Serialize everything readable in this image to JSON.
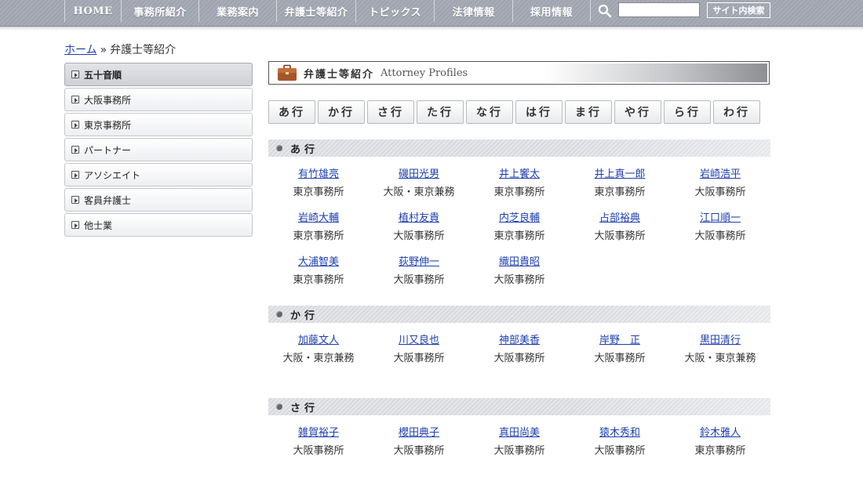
{
  "nav": {
    "items": [
      "HOME",
      "事務所紹介",
      "業務案内",
      "弁護士等紹介",
      "トピックス",
      "法律情報",
      "採用情報"
    ],
    "search_placeholder": "",
    "search_button": "サイト内検索"
  },
  "breadcrumb": {
    "home": "ホーム",
    "separator": "»",
    "current": "弁護士等紹介"
  },
  "sidebar": {
    "items": [
      "五十音順",
      "大阪事務所",
      "東京事務所",
      "パートナー",
      "アソシエイト",
      "客員弁護士",
      "他士業"
    ],
    "active": "五十音順"
  },
  "main": {
    "title_jp": "弁護士等紹介",
    "title_en": "Attorney Profiles",
    "kana": [
      "あ行",
      "か行",
      "さ行",
      "た行",
      "な行",
      "は行",
      "ま行",
      "や行",
      "ら行",
      "わ行"
    ],
    "sections": [
      {
        "title": "あ行",
        "people": [
          {
            "name": "有竹雄亮",
            "office": "東京事務所"
          },
          {
            "name": "磯田光男",
            "office": "大阪・東京兼務"
          },
          {
            "name": "井上饗太",
            "office": "東京事務所"
          },
          {
            "name": "井上真一郎",
            "office": "東京事務所"
          },
          {
            "name": "岩崎浩平",
            "office": "大阪事務所"
          },
          {
            "name": "岩崎大輔",
            "office": "東京事務所"
          },
          {
            "name": "植村友貴",
            "office": "大阪事務所"
          },
          {
            "name": "内芝良輔",
            "office": "東京事務所"
          },
          {
            "name": "占部裕典",
            "office": "大阪事務所"
          },
          {
            "name": "江口順一",
            "office": "大阪事務所"
          },
          {
            "name": "大浦智美",
            "office": "東京事務所"
          },
          {
            "name": "荻野伸一",
            "office": "大阪事務所"
          },
          {
            "name": "織田貴昭",
            "office": "大阪事務所"
          }
        ]
      },
      {
        "title": "か行",
        "people": [
          {
            "name": "加藤文人",
            "office": "大阪・東京兼務"
          },
          {
            "name": "川又良也",
            "office": "大阪事務所"
          },
          {
            "name": "神部美香",
            "office": "大阪事務所"
          },
          {
            "name": "岸野　正",
            "office": "大阪事務所"
          },
          {
            "name": "黒田清行",
            "office": "大阪・東京兼務"
          }
        ]
      },
      {
        "title": "さ行",
        "people": [
          {
            "name": "雑賀裕子",
            "office": "大阪事務所"
          },
          {
            "name": "櫻田典子",
            "office": "大阪事務所"
          },
          {
            "name": "真田尚美",
            "office": "大阪事務所"
          },
          {
            "name": "猿木秀和",
            "office": "大阪事務所"
          },
          {
            "name": "鈴木雅人",
            "office": "東京事務所"
          }
        ]
      }
    ]
  },
  "colors": {
    "link": "#1d3fb0",
    "nav_bg": "#a3a7b2",
    "text": "#333333"
  }
}
